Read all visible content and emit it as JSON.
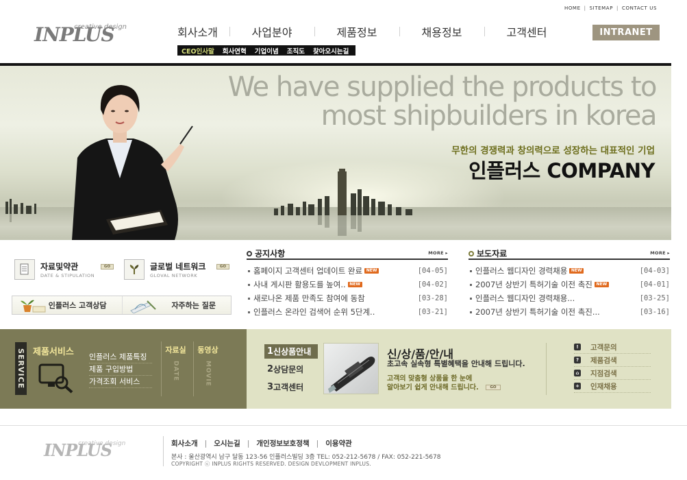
{
  "util_nav": [
    "HOME",
    "SITEMAP",
    "CONTACT US"
  ],
  "logo": {
    "main": "INPLUS",
    "sub": "creative design"
  },
  "gnb": [
    "회사소개",
    "사업분야",
    "제품정보",
    "채용정보",
    "고객센터"
  ],
  "subnav": [
    "CEO인사말",
    "회사연혁",
    "기업이념",
    "조직도",
    "찾아오시는길"
  ],
  "intranet_label": "INTRANET",
  "hero": {
    "slogan_line1": "We have supplied the products to",
    "slogan_line2": "most shipbuilders in korea",
    "tagline_kr": "무한의 경쟁력과 창의력으로 성장하는 대표적인 기업",
    "company": "인플러스 COMPANY"
  },
  "quick_links": [
    {
      "title": "자료및약관",
      "sub": "DATE & STIPULATION"
    },
    {
      "title": "글로벌 네트워크",
      "sub": "GLOVAL NETWORK"
    }
  ],
  "go_label": "GO",
  "consult_bar": [
    "인플러스 고객상담",
    "자주하는 질문"
  ],
  "boards": {
    "notice": {
      "title": "공지사항",
      "more": "MORE",
      "items": [
        {
          "text": "홈페이지 고객센터 업데이트 완료",
          "new": true,
          "date": "[04-05]"
        },
        {
          "text": "사내 게시판 활용도를 높여..",
          "new": true,
          "date": "[04-02]"
        },
        {
          "text": "새로나온 제품 만족도 참여에 동참",
          "new": false,
          "date": "[03-28]"
        },
        {
          "text": "인플러스 온라인 검색어 순위 5단계..",
          "new": false,
          "date": "[03-21]"
        }
      ]
    },
    "press": {
      "title": "보도자료",
      "more": "MORE",
      "items": [
        {
          "text": "인플러스 웹디자인 경력채용",
          "new": true,
          "date": "[04-03]"
        },
        {
          "text": "2007년 상반기 특허기술 이전 촉진",
          "new": true,
          "date": "[04-01]"
        },
        {
          "text": "인플러스 웹디자인 경력채용...",
          "new": false,
          "date": "[03-25]"
        },
        {
          "text": "2007년 상반기 특허기술 이전 촉진...",
          "new": false,
          "date": "[03-16]"
        }
      ]
    }
  },
  "new_label": "NEW",
  "service": {
    "vertical_label": "SERVICE",
    "title": "제품서비스",
    "links": [
      "인플러스 제품특징",
      "제품 구입방법",
      "가격조회 서비스"
    ],
    "col1": {
      "title": "자료실",
      "sub": "DATE"
    },
    "col2": {
      "title": "동영상",
      "sub": "MOVIE"
    }
  },
  "product": {
    "tabs": [
      {
        "num": "1",
        "label": "신상품안내"
      },
      {
        "num": "2",
        "label": "상담문의"
      },
      {
        "num": "3",
        "label": "고객센터"
      }
    ],
    "title": "신/상/품/안/내",
    "subtitle": "초고속 실속형 특별혜택을 안내해 드립니다.",
    "desc_line1": "고객의 맞춤형 상품을 한 눈에",
    "desc_line2": "알아보기 쉽게 안내해 드립니다."
  },
  "cs_links": [
    "고객문의",
    "제품검색",
    "지점검색",
    "인재채용"
  ],
  "footer": {
    "logo_main": "INPLUS",
    "logo_sub": "creative design",
    "nav": [
      "회사소개",
      "오시는길",
      "개인정보보호정책",
      "이용약관"
    ],
    "address": "본사 : 울산광역시 남구 달동 123-56 인플러스빌딩 3층   TEL: 052-212-5678  /  FAX: 052-221-5678",
    "copyright": "COPYRIGHT ⓒ INPLUS RIGHTS RESERVED. DESIGN  DEVLOPMENT INPLUS."
  }
}
